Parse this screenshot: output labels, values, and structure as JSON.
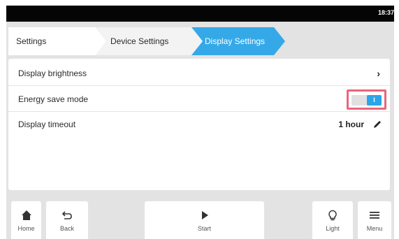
{
  "status_bar": {
    "time": "18:37"
  },
  "breadcrumb": {
    "items": [
      {
        "label": "Settings"
      },
      {
        "label": "Device Settings"
      },
      {
        "label": "Display Settings"
      }
    ]
  },
  "settings_list": {
    "rows": [
      {
        "label": "Display brightness",
        "control": "chevron-right-icon"
      },
      {
        "label": "Energy save mode",
        "control": "toggle",
        "toggle_on": true,
        "toggle_glyph": "I"
      },
      {
        "label": "Display timeout",
        "value": "1 hour",
        "control": "pencil-icon"
      }
    ]
  },
  "bottom_bar": {
    "home_label": "Home",
    "back_label": "Back",
    "start_label": "Start",
    "light_label": "Light",
    "menu_label": "Menu"
  },
  "colors": {
    "accent": "#35a9e8",
    "highlight_border": "#e8667a",
    "status_bar": "#050505",
    "background": "#e3e3e3"
  }
}
